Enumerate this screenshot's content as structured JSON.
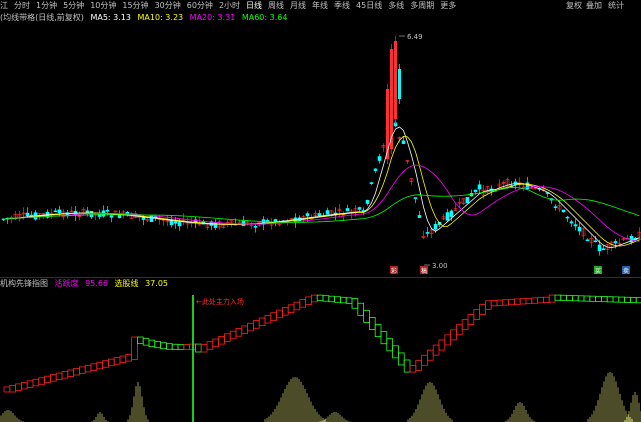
{
  "toolbar": {
    "items": [
      "江",
      "分时",
      "1分钟",
      "5分钟",
      "10分钟",
      "15分钟",
      "30分钟",
      "60分钟",
      "2小时",
      "日线",
      "周线",
      "月线",
      "年线",
      "季线",
      "45日线",
      "多线",
      "多周期",
      "更多"
    ],
    "active_index": 9,
    "restore_label": "复权",
    "overlay_label": "叠加",
    "stat_label": "统计"
  },
  "main_legend": {
    "title": "(均线带格(日线,前复权)",
    "ma5": "MA5: 3.13",
    "ma10": "MA10: 3.23",
    "ma20": "MA20: 3.31",
    "ma60": "MA60: 3.64",
    "ma5_color": "#ffffff",
    "ma10_color": "#ffff00",
    "ma20_color": "#ff00ff",
    "ma60_color": "#00ff00"
  },
  "price_labels": {
    "high": "6.49",
    "low": "3.00"
  },
  "signal_markers": [
    "彩",
    "稿",
    "买",
    "卖"
  ],
  "indicator_legend": {
    "name": "机构先锋指图",
    "line1_label": "活跃度",
    "line1_value": "95.66",
    "line2_label": "选股线",
    "line2_value": "37.05",
    "line1_color": "#ff00ff",
    "line2_color": "#ffff00"
  },
  "annotation": {
    "text": "←此处主力入场"
  },
  "colors": {
    "up": "#ff3030",
    "down": "#00ffff",
    "up_indicator": "#ff2020",
    "down_indicator": "#20ff20",
    "volume": "#ffff88"
  }
}
